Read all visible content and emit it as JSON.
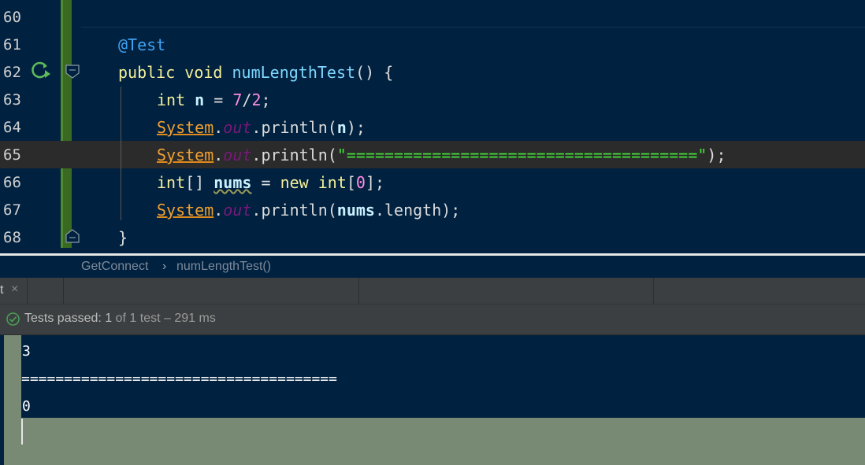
{
  "editor": {
    "lines": [
      {
        "num": "60"
      },
      {
        "num": "61",
        "ann": "@Test"
      },
      {
        "num": "62",
        "kw1": "public",
        "kw2": "void",
        "fn": "numLengthTest",
        "rest": "()",
        "brace": "{"
      },
      {
        "num": "63",
        "kw": "int",
        "var": "n",
        "eq": "=",
        "n1": "7",
        "slash": "/",
        "n2": "2",
        "semi": ";"
      },
      {
        "num": "64",
        "sys": "System",
        "dot1": ".",
        "out": "out",
        "call": ".println(",
        "arg": "n",
        "end": ");"
      },
      {
        "num": "65",
        "sys": "System",
        "dot1": ".",
        "out": "out",
        "call": ".println(",
        "str": "\"=====================================\"",
        "end": ");"
      },
      {
        "num": "66",
        "kw": "int",
        "br": "[]",
        "var": "nums",
        "eq": "=",
        "kwnew": "new",
        "kw2": "int",
        "lb": "[",
        "n0": "0",
        "rb": "];"
      },
      {
        "num": "67",
        "sys": "System",
        "dot1": ".",
        "out": "out",
        "call": ".println(",
        "arg": "nums",
        "tail": ".length);"
      },
      {
        "num": "68",
        "brace": "}"
      }
    ]
  },
  "breadcrumb": {
    "class_name": "GetConnect",
    "separator": "›",
    "method_name": "numLengthTest()"
  },
  "toolwindow": {
    "tab_label": "t",
    "close_glyph": "×"
  },
  "status": {
    "prefix": "Tests passed:",
    "passed": "1",
    "of_text": "of 1 test",
    "dash": "–",
    "duration": "291 ms"
  },
  "console": {
    "lines": [
      "3",
      "=====================================",
      "0"
    ]
  },
  "colors": {
    "editor_bg": "#00213f",
    "gutter_change": "#3a6a22",
    "console_gutter": "#788a74",
    "pass_icon": "#499c54"
  }
}
